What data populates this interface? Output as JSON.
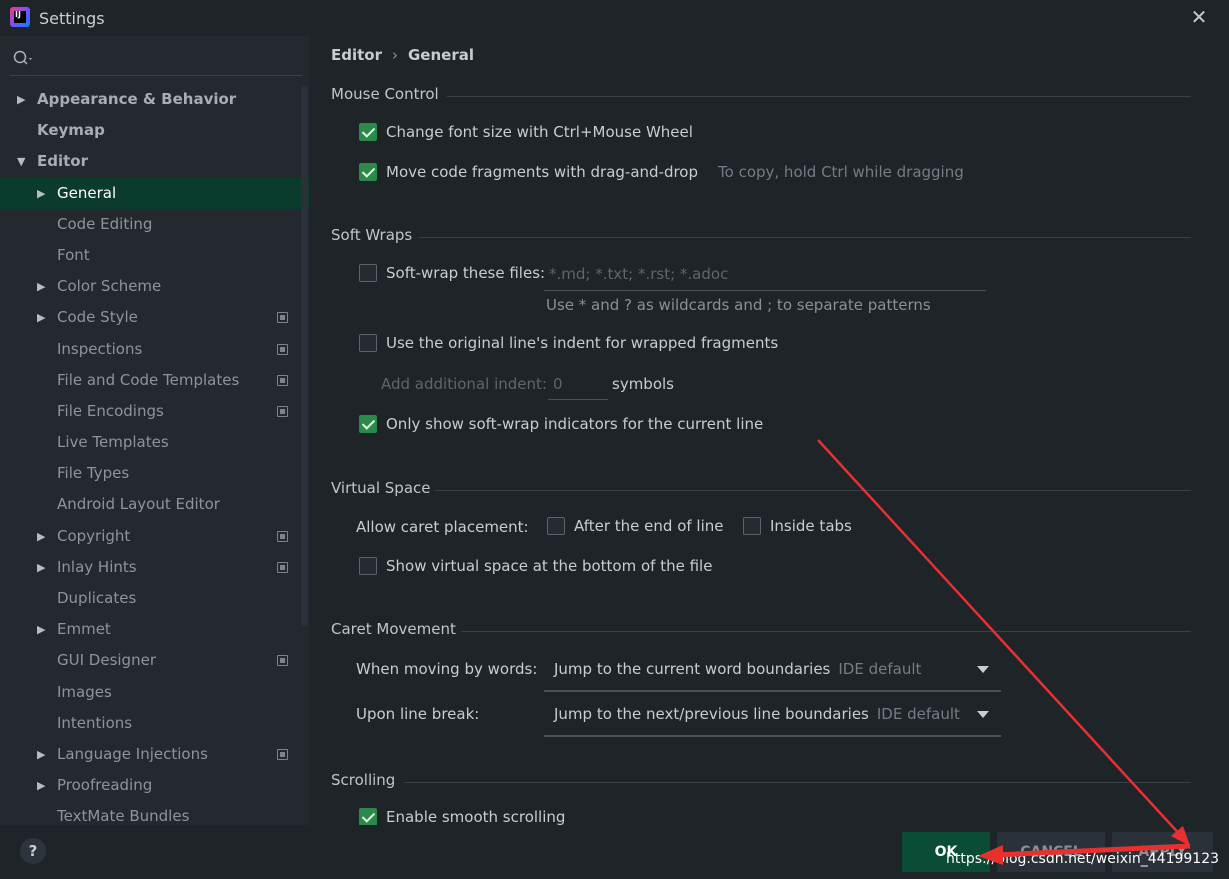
{
  "window": {
    "title": "Settings",
    "close_icon": "close-icon"
  },
  "sidebar": {
    "search_placeholder": "",
    "items": [
      {
        "label": "Appearance & Behavior",
        "level": 0,
        "arrow": "▶",
        "gear": false
      },
      {
        "label": "Keymap",
        "level": 0,
        "arrow": "",
        "gear": false
      },
      {
        "label": "Editor",
        "level": 0,
        "arrow": "▼",
        "gear": false
      },
      {
        "label": "General",
        "level": 1,
        "arrow": "▶",
        "gear": false,
        "selected": true
      },
      {
        "label": "Code Editing",
        "level": 1,
        "arrow": "",
        "gear": false
      },
      {
        "label": "Font",
        "level": 1,
        "arrow": "",
        "gear": false
      },
      {
        "label": "Color Scheme",
        "level": 1,
        "arrow": "▶",
        "gear": false
      },
      {
        "label": "Code Style",
        "level": 1,
        "arrow": "▶",
        "gear": true
      },
      {
        "label": "Inspections",
        "level": 1,
        "arrow": "",
        "gear": true
      },
      {
        "label": "File and Code Templates",
        "level": 1,
        "arrow": "",
        "gear": true
      },
      {
        "label": "File Encodings",
        "level": 1,
        "arrow": "",
        "gear": true
      },
      {
        "label": "Live Templates",
        "level": 1,
        "arrow": "",
        "gear": false
      },
      {
        "label": "File Types",
        "level": 1,
        "arrow": "",
        "gear": false
      },
      {
        "label": "Android Layout Editor",
        "level": 1,
        "arrow": "",
        "gear": false
      },
      {
        "label": "Copyright",
        "level": 1,
        "arrow": "▶",
        "gear": true
      },
      {
        "label": "Inlay Hints",
        "level": 1,
        "arrow": "▶",
        "gear": true
      },
      {
        "label": "Duplicates",
        "level": 1,
        "arrow": "",
        "gear": false
      },
      {
        "label": "Emmet",
        "level": 1,
        "arrow": "▶",
        "gear": false
      },
      {
        "label": "GUI Designer",
        "level": 1,
        "arrow": "",
        "gear": true
      },
      {
        "label": "Images",
        "level": 1,
        "arrow": "",
        "gear": false
      },
      {
        "label": "Intentions",
        "level": 1,
        "arrow": "",
        "gear": false
      },
      {
        "label": "Language Injections",
        "level": 1,
        "arrow": "▶",
        "gear": true
      },
      {
        "label": "Proofreading",
        "level": 1,
        "arrow": "▶",
        "gear": false
      },
      {
        "label": "TextMate Bundles",
        "level": 1,
        "arrow": "",
        "gear": false
      }
    ]
  },
  "breadcrumb": {
    "parent": "Editor",
    "sep": "›",
    "current": "General"
  },
  "mouse_control": {
    "title": "Mouse Control",
    "font_size_label": "Change font size with Ctrl+Mouse Wheel",
    "drag_drop_label": "Move code fragments with drag-and-drop",
    "drag_drop_hint": "To copy, hold Ctrl while dragging"
  },
  "soft_wraps": {
    "title": "Soft Wraps",
    "files_label": "Soft-wrap these files:",
    "files_placeholder": "*.md; *.txt; *.rst; *.adoc",
    "files_hint": "Use * and ? as wildcards and ; to separate patterns",
    "indent_label": "Use the original line's indent for wrapped fragments",
    "additional_indent_label": "Add additional indent:",
    "additional_indent_value": "0",
    "symbols_label": "symbols",
    "indicators_label": "Only show soft-wrap indicators for the current line"
  },
  "virtual_space": {
    "title": "Virtual Space",
    "caret_label": "Allow caret placement:",
    "after_end_label": "After the end of line",
    "inside_tabs_label": "Inside tabs",
    "bottom_label": "Show virtual space at the bottom of the file"
  },
  "caret_movement": {
    "title": "Caret Movement",
    "words_label": "When moving by words:",
    "words_value": "Jump to the current word boundaries",
    "words_hint": "IDE default",
    "line_break_label": "Upon line break:",
    "line_break_value": "Jump to the next/previous line boundaries",
    "line_break_hint": "IDE default"
  },
  "scrolling": {
    "title": "Scrolling",
    "smooth_label": "Enable smooth scrolling"
  },
  "buttons": {
    "help": "?",
    "ok": "OK",
    "cancel": "CANCEL",
    "apply": "APPLY"
  },
  "watermark": "https://blog.csdn.net/weixin_44199123",
  "colors": {
    "accent": "#2b8a4a",
    "selection": "#0b3b2d",
    "annotation": "#e8302f"
  }
}
